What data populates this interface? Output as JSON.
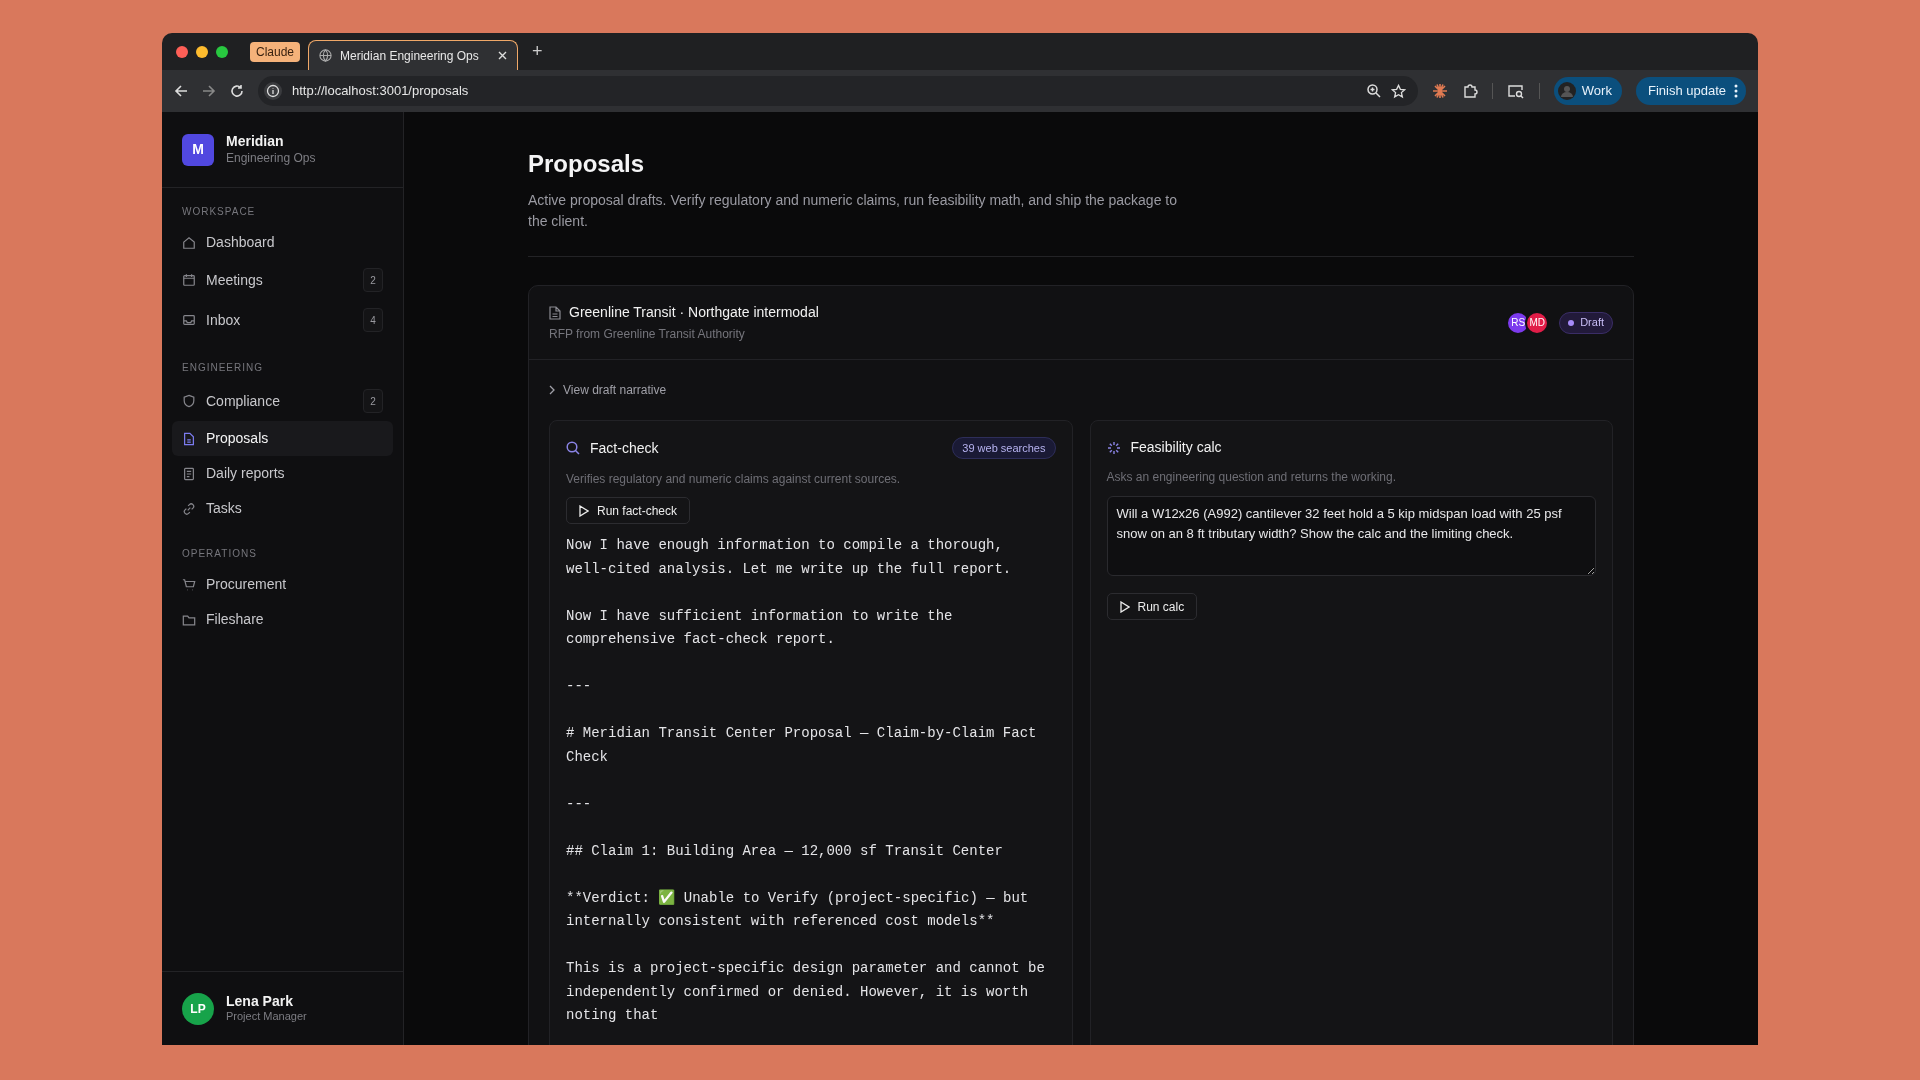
{
  "browser": {
    "tab_group": "Claude",
    "tabs": [
      {
        "label": "Meridian Engineering Ops",
        "selected": true
      }
    ],
    "new_tab": "+",
    "url": "http://localhost:3001/proposals",
    "profile": "Work",
    "update_button": "Finish update"
  },
  "sidebar": {
    "brand": {
      "initial": "M",
      "name": "Meridian",
      "subtitle": "Engineering Ops"
    },
    "sections": [
      {
        "heading": "WORKSPACE",
        "items": [
          {
            "label": "Dashboard",
            "selected": false
          },
          {
            "label": "Meetings",
            "badge": "2",
            "selected": false
          },
          {
            "label": "Inbox",
            "badge": "4",
            "selected": false
          }
        ]
      },
      {
        "heading": "ENGINEERING",
        "items": [
          {
            "label": "Compliance",
            "badge": "2",
            "selected": false
          },
          {
            "label": "Proposals",
            "selected": true
          },
          {
            "label": "Daily reports",
            "selected": false
          },
          {
            "label": "Tasks",
            "selected": false
          }
        ]
      },
      {
        "heading": "OPERATIONS",
        "items": [
          {
            "label": "Procurement",
            "selected": false
          },
          {
            "label": "Fileshare",
            "selected": false
          }
        ]
      }
    ],
    "user": {
      "initials": "LP",
      "name": "Lena Park",
      "role": "Project Manager"
    }
  },
  "page": {
    "title": "Proposals",
    "description": "Active proposal drafts. Verify regulatory and numeric claims, run feasibility math, and ship the package to the client."
  },
  "proposal": {
    "title": "Greenline Transit · Northgate intermodal",
    "subtitle": "RFP from Greenline Transit Authority",
    "avatars": [
      {
        "initials": "RS",
        "color": "#7c3aed"
      },
      {
        "initials": "MD",
        "color": "#e11d48"
      }
    ],
    "status": "Draft",
    "disclosure": "View draft narrative",
    "fact_check": {
      "title": "Fact-check",
      "badge": "39 web searches",
      "description": "Verifies regulatory and numeric claims against current sources.",
      "button": "Run fact-check",
      "report": [
        [
          "Now I have enough information to compile a thorough,",
          "well-cited analysis. Let me write up the full report."
        ],
        [
          "Now I have sufficient information to write the",
          "comprehensive fact-check report."
        ],
        [
          "---"
        ],
        [
          "# Meridian Transit Center Proposal — Claim-by-Claim Fact",
          "Check"
        ],
        [
          "---"
        ],
        [
          "## Claim 1: Building Area — 12,000 sf Transit Center"
        ],
        [
          "**Verdict: ✅ Unable to Verify (project-specific) — but",
          "internally consistent with referenced cost models**"
        ],
        [
          "This is a project-specific design parameter and cannot be",
          "independently confirmed or denied. However, it is worth",
          "noting that"
        ]
      ]
    },
    "feasibility": {
      "title": "Feasibility calc",
      "description": "Asks an engineering question and returns the working.",
      "question": "Will a W12x26 (A992) cantilever 32 feet hold a 5 kip midspan load with 25 psf snow on an 8 ft tributary width? Show the calc and the limiting check.",
      "button": "Run calc"
    }
  }
}
